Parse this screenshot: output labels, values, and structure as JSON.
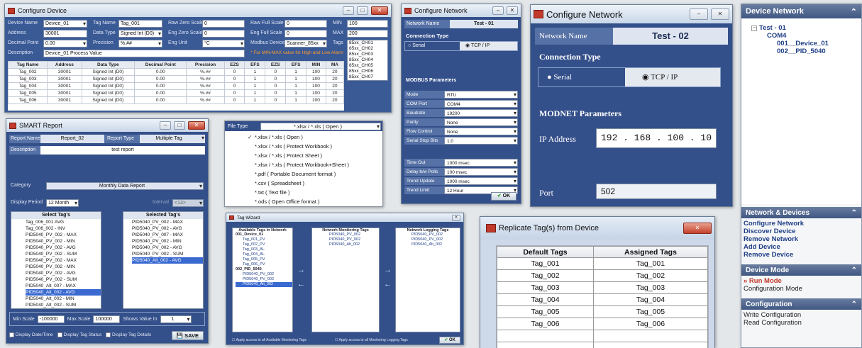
{
  "configure_device": {
    "title": "Configure Device",
    "fields": {
      "device_name_label": "Device Name",
      "device_name": "Device_01",
      "tag_name_label": "Tag Name",
      "tag_name": "Tag_001",
      "raw_zero_label": "Raw Zero Scale",
      "raw_zero": "0",
      "raw_full_label": "Raw Full Scale",
      "raw_full": "0",
      "min_label": "MIN",
      "min": "100",
      "address_label": "Address",
      "address": "30001",
      "data_type_label": "Data Type",
      "data_type": "Signed Int (D0)",
      "eng_zero_label": "Eng Zero Scale",
      "eng_zero": "0",
      "eng_full_label": "Eng Full Scale",
      "eng_full": "0",
      "max_label": "MAX",
      "max": "200",
      "decimal_label": "Decimal Point",
      "decimal": "0.00",
      "precision_label": "Precision",
      "precision": "%.##",
      "eng_unit_label": "Eng Unit",
      "eng_unit": "°C",
      "modbus_label": "Modbus Device",
      "modbus": "Scanner_85xx",
      "tags_label": "Tags",
      "description_label": "Description",
      "description": "Device_01 Process Value",
      "warning": "* For MIN-MAX value for High and Low Alarm"
    },
    "tag_list": [
      "85xx_CH01",
      "85xx_CH02",
      "85xx_CH03",
      "85xx_CH04",
      "85xx_CH05",
      "85xx_CH06",
      "85xx_CH07"
    ],
    "table": {
      "headers": [
        "Tag Name",
        "Address",
        "Data Type",
        "Decimal Point",
        "Precision",
        "EZS",
        "EFS",
        "EZS",
        "EFS",
        "MIN",
        "MA"
      ],
      "rows": [
        [
          "Tag_002",
          "30001",
          "Signed Int (D0)",
          "0.00",
          "%.##",
          "0",
          "1",
          "0",
          "1",
          "100",
          "20"
        ],
        [
          "Tag_003",
          "30001",
          "Signed Int (D0)",
          "0.00",
          "%.##",
          "0",
          "1",
          "0",
          "1",
          "100",
          "20"
        ],
        [
          "Tag_004",
          "30001",
          "Signed Int (D0)",
          "0.00",
          "%.##",
          "0",
          "1",
          "0",
          "1",
          "100",
          "20"
        ],
        [
          "Tag_005",
          "30001",
          "Signed Int (D0)",
          "0.00",
          "%.##",
          "0",
          "1",
          "0",
          "1",
          "100",
          "20"
        ],
        [
          "Tag_006",
          "30001",
          "Signed Int (D0)",
          "0.00",
          "%.##",
          "0",
          "1",
          "0",
          "1",
          "100",
          "20"
        ]
      ]
    }
  },
  "configure_network_small": {
    "title": "Configure Network",
    "network_name_label": "Network Name",
    "network_name": "Test - 01",
    "connection_type": "Connection Type",
    "serial": "Serial",
    "tcp": "TCP / IP",
    "modbus_params": "MODBUS Parameters",
    "rows": [
      {
        "label": "Mode",
        "value": "RTU"
      },
      {
        "label": "COM Port",
        "value": "COM4"
      },
      {
        "label": "Baudrate",
        "value": "19200"
      },
      {
        "label": "Parity",
        "value": "None"
      },
      {
        "label": "Flow Control",
        "value": "None"
      },
      {
        "label": "Serial Stop Bits",
        "value": "1.0"
      }
    ],
    "timing": [
      {
        "label": "Time Out",
        "value": "1000 msec"
      },
      {
        "label": "Delay b/w Polls",
        "value": "100 msec"
      },
      {
        "label": "Trend Update",
        "value": "1000 msec"
      },
      {
        "label": "Trend Limit",
        "value": "12 Hour"
      }
    ],
    "ok": "OK"
  },
  "configure_network_large": {
    "title": "Configure Network",
    "network_name_label": "Network Name",
    "network_name": "Test - 02",
    "connection_type": "Connection Type",
    "serial": "Serial",
    "tcp": "TCP / IP",
    "modnet_params": "MODNET Parameters",
    "ip_label": "IP Address",
    "ip": "192 . 168 . 100 . 10",
    "port_label": "Port",
    "port": "502"
  },
  "device_network": {
    "header": "Device Network",
    "tree": {
      "network": "Test - 01",
      "port": "COM4",
      "devices": [
        "001__Device_01",
        "002__PID_5040"
      ]
    },
    "sections": [
      {
        "title": "Network & Devices",
        "items": [
          {
            "label": "Configure Network",
            "style": "link"
          },
          {
            "label": "Discover Device",
            "style": "link"
          },
          {
            "label": "Remove Network",
            "style": "link"
          },
          {
            "label": "Add Device",
            "style": "link"
          },
          {
            "label": "Remove Device",
            "style": "link"
          }
        ]
      },
      {
        "title": "Device Mode",
        "items": [
          {
            "label": "» Run Mode",
            "style": "run"
          },
          {
            "label": "Configuration Mode",
            "style": "plain"
          }
        ]
      },
      {
        "title": "Configuration",
        "items": [
          {
            "label": "Write Configuration",
            "style": "plain"
          },
          {
            "label": "Read Configuration",
            "style": "plain"
          }
        ]
      }
    ]
  },
  "smart_report": {
    "title": "SMART Report",
    "report_name_label": "Report Name",
    "report_name": "Report_02",
    "report_type_label": "Report Type",
    "report_type": "Multiple Tag",
    "description_label": "Description",
    "description": "test report",
    "category_label": "Category",
    "category": "Monthly Data Report",
    "display_period_label": "Display Period",
    "display_period": "12 Month",
    "interval_label": "Interval",
    "interval": "<13>",
    "select_tags_header": "Select Tag's",
    "select_tags": [
      "Tag_006_001 AVG",
      "Tag_006_002 - INV",
      "PID5040_PV_002 - MAX",
      "PID5040_PV_002 - MIN",
      "PID5040_PV_002 - AVG",
      "PID5040_PV_002 - SUM",
      "PID5040_PV_002 - MAX",
      "PID5040_PV_002 - MIN",
      "PID5040_PV_002 - AVG",
      "PID5040_PV_002 - SUM",
      "PID5040_Alt_007 - MAX",
      "PID5040_Alt_002 - AVG",
      "PID5040_Alt_002 - MIN",
      "PID5040_Alt_002 - SUM"
    ],
    "selected_tags_header": "Selected Tag's",
    "selected_tags": [
      "PID5040_PV_002 - MAX",
      "PID5040_PV_002 - AVG",
      "PID5040_PV_007 - MAX",
      "PID5040_PV_002 - MIN",
      "PID5040_PV_002 - AVG",
      "PID5040_PV_002 - SUM",
      "PID5040_Alt_002 - AVG"
    ],
    "min_scale_label": "Min Scale",
    "min_scale": "-100000",
    "max_scale_label": "Max Scale",
    "max_scale": "100000",
    "shows_label": "Shows Value In",
    "shows": "1",
    "cb_date": "Display Date/Time",
    "cb_status": "Display Tag Status",
    "cb_details": "Display Tag Details",
    "save": "SAVE"
  },
  "file_type": {
    "label": "File Type",
    "selected": "*.xlsx / *.xls ( Open )",
    "options": [
      "*.xlsx / *.xls ( Open )",
      "*.xlsx / *.xls ( Protect Workbook )",
      "*.xlsx / *.xls ( Protect Sheet )",
      "*.xlsx / *.xls ( Protect Workbook+Sheet )",
      "*.pdf ( Portable Document format )",
      "*.csv ( Spreadsheet )",
      "*.txt ( Text file )",
      "*.ods ( Open Office format )"
    ]
  },
  "tag_wizard": {
    "title": "Tag Wizard",
    "available_header": "Available Tags in Network",
    "available": [
      "001_Device_01",
      "Tag_001_PV",
      "Tag_002_PV",
      "Tag_003_AL",
      "Tag_004_AL",
      "Tag_005_PV",
      "Tag_006_PV",
      "002_PID_5040",
      "PID5040_PV_002",
      "PID5040_PV_002",
      "PID5040_Alt_002"
    ],
    "monitoring_header": "Network Monitoring Tags",
    "monitoring": [
      "PID5040_PV_002",
      "PID5040_PV_002",
      "PID5040_Alt_002"
    ],
    "logging_header": "Network Logging Tags",
    "logging": [
      "PID5040_PV_002",
      "PID5040_PV_002",
      "PID5040_Alt_002"
    ],
    "cb_monitor": "Apply access to all Available Monitoring Tags",
    "cb_logging": "Apply access to all Monitoring Logging Tags",
    "ok": "OK"
  },
  "replicate": {
    "title": "Replicate Tag(s) from Device",
    "headers": [
      "Default Tags",
      "Assigned Tags"
    ],
    "rows": [
      [
        "Tag_001",
        "Tag_001"
      ],
      [
        "Tag_002",
        "Tag_002"
      ],
      [
        "Tag_003",
        "Tag_003"
      ],
      [
        "Tag_004",
        "Tag_004"
      ],
      [
        "Tag_005",
        "Tag_005"
      ],
      [
        "Tag_006",
        "Tag_006"
      ]
    ]
  }
}
